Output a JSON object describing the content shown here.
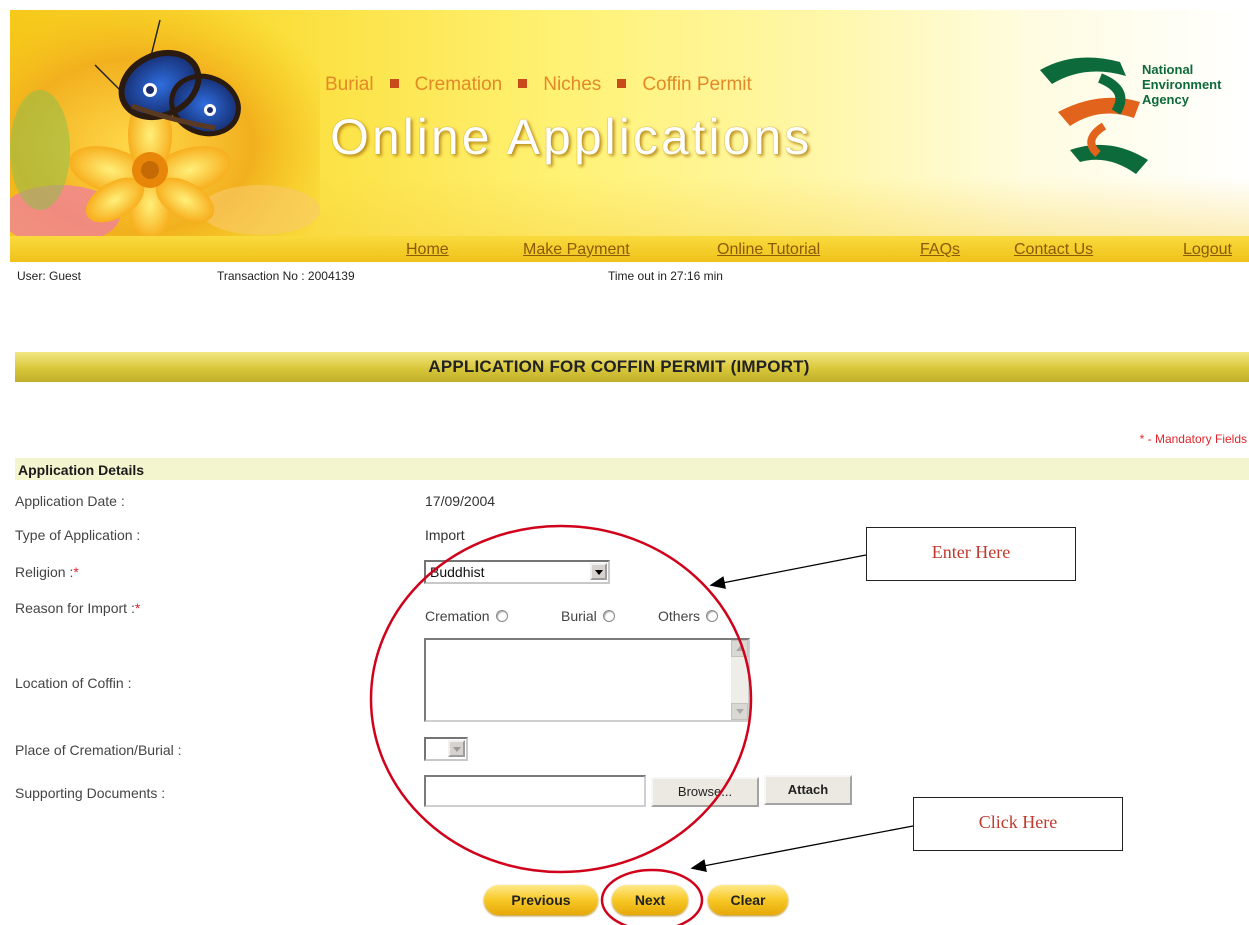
{
  "banner": {
    "top_nav": [
      "Burial",
      "Cremation",
      "Niches",
      "Coffin Permit"
    ],
    "title": "Online Applications",
    "agency_lines": [
      "National",
      "Environment",
      "Agency"
    ],
    "colors": {
      "banner_yellow": "#f6c81a",
      "link_orange": "#e38a26",
      "agency_green": "#0d6a3b",
      "agency_orange": "#e2631b"
    }
  },
  "nav": {
    "home": "Home",
    "make_payment": "Make Payment",
    "online_tutorial": "Online Tutorial",
    "faqs": "FAQs",
    "contact_us": "Contact Us",
    "logout": "Logout"
  },
  "status": {
    "user": "User: Guest",
    "transaction": "Transaction No : 2004139",
    "timeout": "Time out in 27:16 min"
  },
  "form": {
    "title": "APPLICATION FOR COFFIN PERMIT (IMPORT)",
    "mandatory_note": "* - Mandatory Fields",
    "section_header": "Application Details",
    "required_marker": "*",
    "application_date_label": "Application Date :",
    "application_date_value": "17/09/2004",
    "type_label": "Type of Application :",
    "type_value": "Import",
    "religion_label": "Religion :",
    "religion_value": "Buddhist",
    "reason_label": "Reason for Import :",
    "reason_options": [
      "Cremation",
      "Burial",
      "Others"
    ],
    "location_label": "Location of Coffin :",
    "location_value": "",
    "place_label": "Place of Cremation/Burial :",
    "place_value": "",
    "documents_label": "Supporting Documents :",
    "documents_value": "",
    "browse_label": "Browse...",
    "attach_label": "Attach",
    "previous_label": "Previous",
    "next_label": "Next",
    "clear_label": "Clear"
  },
  "annotations": {
    "enter_here": "Enter Here",
    "click_here": "Click Here",
    "highlight_color": "#d0021b"
  }
}
